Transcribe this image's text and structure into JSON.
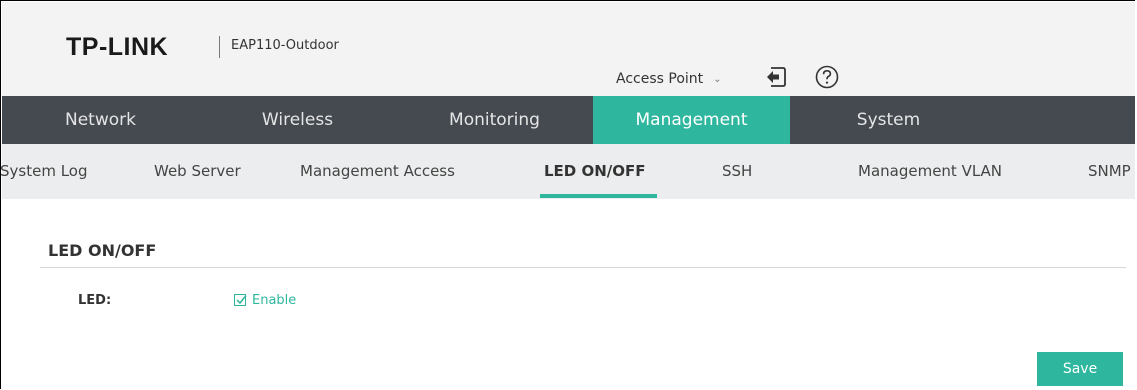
{
  "header": {
    "brand": "TP-LINK",
    "model": "EAP110-Outdoor",
    "mode_select": "Access Point",
    "icons": {
      "logout": "logout-icon",
      "help": "help-icon"
    }
  },
  "main_nav": {
    "tabs": [
      {
        "label": "Network"
      },
      {
        "label": "Wireless"
      },
      {
        "label": "Monitoring"
      },
      {
        "label": "Management"
      },
      {
        "label": "System"
      }
    ],
    "active": "Management"
  },
  "sub_nav": {
    "tabs": [
      {
        "label": "System Log"
      },
      {
        "label": "Web Server"
      },
      {
        "label": "Management Access"
      },
      {
        "label": "LED ON/OFF"
      },
      {
        "label": "SSH"
      },
      {
        "label": "Management VLAN"
      },
      {
        "label": "SNMP"
      }
    ],
    "active": "LED ON/OFF"
  },
  "content": {
    "section_title": "LED ON/OFF",
    "led_label": "LED:",
    "led_checkbox_label": "Enable",
    "led_checked": true,
    "save_label": "Save"
  },
  "colors": {
    "accent": "#2eb79e",
    "nav_bg": "#454a50",
    "header_bg": "#f3f3f3",
    "subnav_bg": "#ecedee"
  }
}
